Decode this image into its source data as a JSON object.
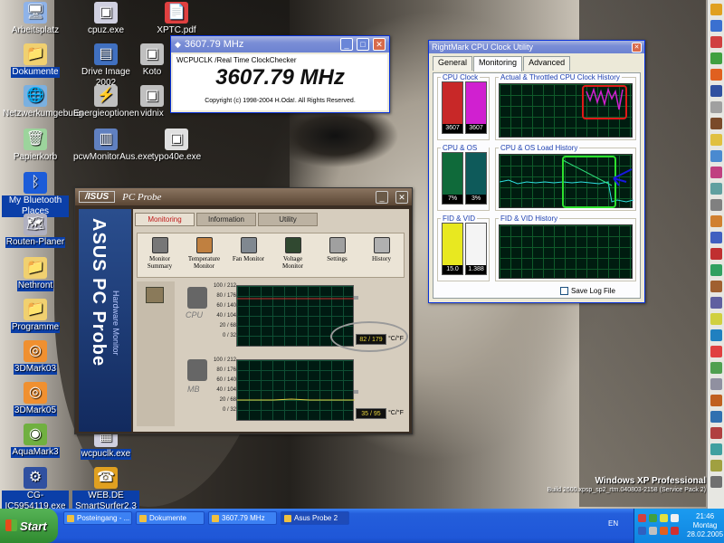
{
  "desktop_icons": [
    {
      "label": "Arbeitsplatz",
      "glyph": "🖥",
      "x": 0
    },
    {
      "label": "Dokumente",
      "glyph": "📁"
    },
    {
      "label": "Netzwerkumgebung",
      "glyph": "🌐"
    },
    {
      "label": "Papierkorb",
      "glyph": "🗑"
    },
    {
      "label": "My Bluetooth Places",
      "glyph": "ᛒ"
    },
    {
      "label": "Routen-Planer",
      "glyph": "🗺"
    },
    {
      "label": "Nethront",
      "glyph": "📁"
    },
    {
      "label": "Programme",
      "glyph": "📁"
    },
    {
      "label": "3DMark03",
      "glyph": "◎"
    },
    {
      "label": "3DMark05",
      "glyph": "◎"
    },
    {
      "label": "AquaMark3",
      "glyph": "◉"
    },
    {
      "label": "CG-IC5954119.exe",
      "glyph": "⚙"
    },
    {
      "label": "cpuz.exe",
      "glyph": "▣"
    },
    {
      "label": "Drive Image 2002",
      "glyph": "▤"
    },
    {
      "label": "Energieoptionen",
      "glyph": "⚡"
    },
    {
      "label": "pcwMonitorAus.exe",
      "glyph": "▥"
    },
    {
      "label": "wcpuclk.exe",
      "glyph": "▦"
    },
    {
      "label": "WEB.DE SmartSurfer2.3",
      "glyph": "☎"
    },
    {
      "label": "XPTC.pdf",
      "glyph": "📄"
    },
    {
      "label": "Koto",
      "glyph": "▣"
    },
    {
      "label": "vidnix",
      "glyph": "▣"
    },
    {
      "label": "typo40e.exe",
      "glyph": "▣"
    }
  ],
  "clock_checker": {
    "title": "3607.79 MHz",
    "program": "WCPUCLK /Real Time ClockChecker",
    "mhz": "3607.79 MHz",
    "copyright": "Copyright (c) 1998-2004 H.Oda!. All Rights Reserved."
  },
  "rightmark": {
    "title": "RightMark CPU Clock Utility",
    "tabs": [
      "General",
      "Monitoring",
      "Advanced"
    ],
    "active_tab": "Monitoring",
    "groups": {
      "cpu_clock": "CPU Clock",
      "clock_history": "Actual & Throttled CPU Clock History",
      "os_load": "CPU & OS Load",
      "load_history": "CPU & OS Load History",
      "fid_vid": "FID & VID",
      "fid_vid_history": "FID & VID History"
    },
    "cpu_clock_values": [
      "3607",
      "3607"
    ],
    "cpu_clock_levels": [
      1.0,
      1.0
    ],
    "os_load_values": [
      "7%",
      "3%"
    ],
    "os_load_levels": [
      0.07,
      0.03
    ],
    "fid_vid_values": [
      "15.0",
      "1.388"
    ],
    "fid_vid_levels": [
      1.0,
      1.0
    ],
    "save_log_label": "Save Log File",
    "annotation_colors": {
      "red": "#e01818",
      "green": "#2ee02e",
      "blue": "#1818e0"
    }
  },
  "probe": {
    "title": "PC Probe",
    "logo": "/ISUS",
    "side_title": "ASUS PC Probe",
    "side_sub": "Hardware Monitor",
    "tabs": [
      "Monitoring",
      "Information",
      "Utility"
    ],
    "active_tab": "Monitoring",
    "tools": [
      {
        "label": "Monitor Summary"
      },
      {
        "label": "Temperature Monitor"
      },
      {
        "label": "Fan Monitor"
      },
      {
        "label": "Voltage Monitor"
      },
      {
        "label": "Settings"
      },
      {
        "label": "History"
      }
    ],
    "scale": [
      "100 / 212",
      "80 / 176",
      "60 / 140",
      "40 / 104",
      "20 / 68",
      "0 / 32"
    ],
    "cpu_label": "CPU",
    "mb_label": "MB",
    "cpu_reading": "82 / 179",
    "mb_reading": "35 / 95",
    "unit": "°C/°F"
  },
  "taskbar": {
    "start": "Start",
    "buttons": [
      "Posteingang - ...",
      "Dokumente",
      "3607.79 MHz",
      "Asus Probe 2"
    ],
    "language": "EN",
    "time": "21:46",
    "day": "Montag",
    "date": "28.02.2005"
  },
  "watermark": {
    "line1": "Windows XP Professional",
    "line2": "Build 2600.xpsp_sp2_rtm.040803-2158 (Service Pack 2)"
  }
}
